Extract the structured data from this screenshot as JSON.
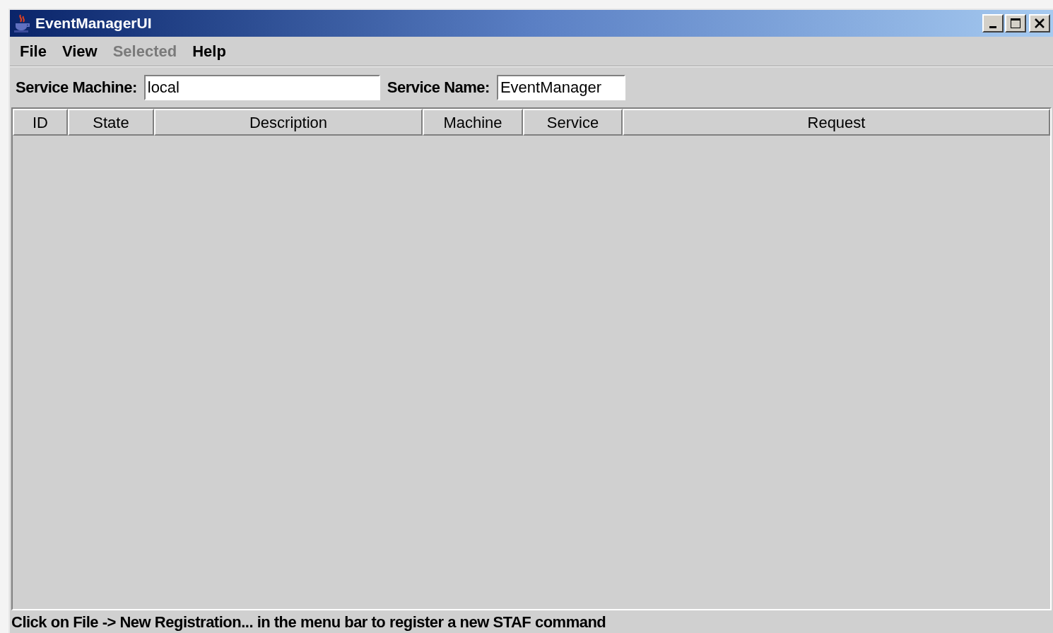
{
  "window": {
    "title": "EventManagerUI"
  },
  "menu": [
    {
      "label": "File",
      "disabled": false
    },
    {
      "label": "View",
      "disabled": false
    },
    {
      "label": "Selected",
      "disabled": true
    },
    {
      "label": "Help",
      "disabled": false
    }
  ],
  "fields": [
    {
      "label": "Service Machine:",
      "value": "local"
    },
    {
      "label": "Service Name:",
      "value": "EventManager"
    }
  ],
  "table": {
    "columns": [
      "ID",
      "State",
      "Description",
      "Machine",
      "Service",
      "Request"
    ]
  },
  "status_bar": "Click on File -> New Registration... in the menu bar to register a new STAF command"
}
